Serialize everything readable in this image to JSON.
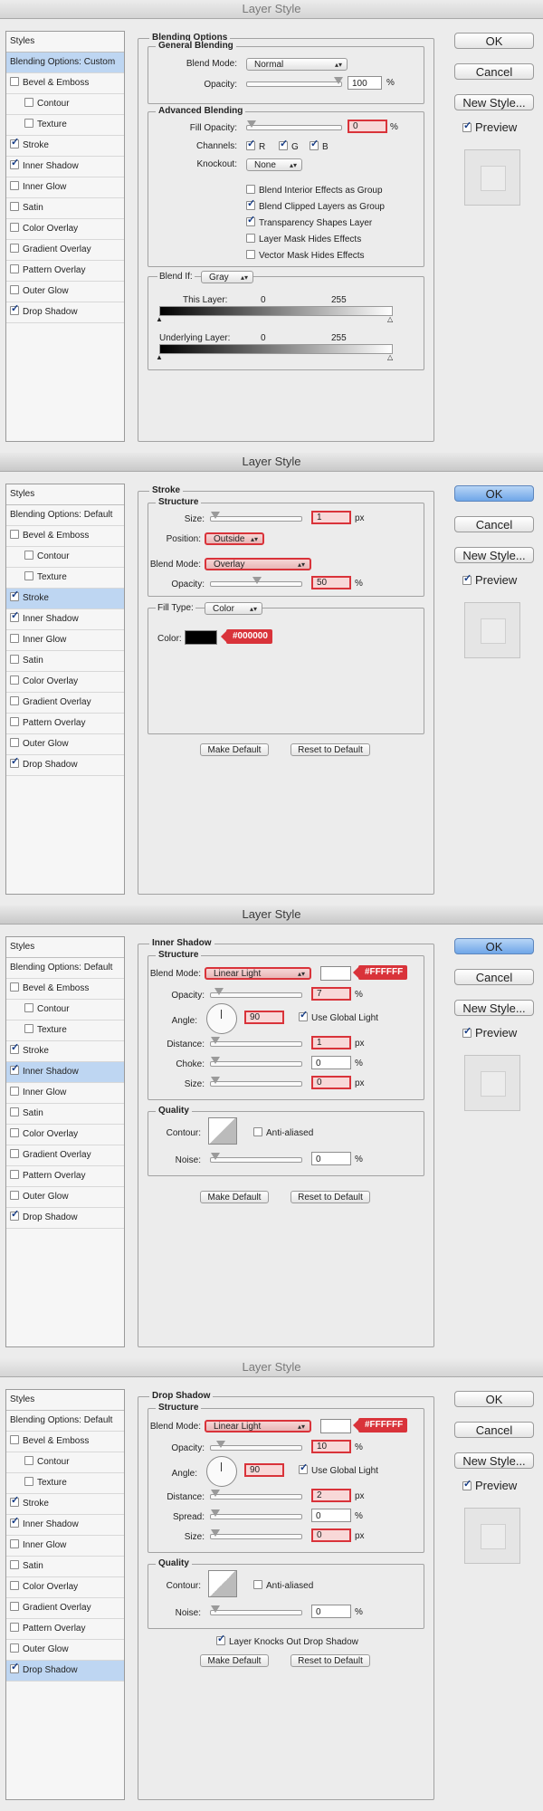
{
  "panels": [
    {
      "title": "Layer Style",
      "sidebar_header": "Styles",
      "sidebar": [
        {
          "label": "Blending Options: Custom",
          "checked": null,
          "selected": true
        },
        {
          "label": "Bevel & Emboss",
          "checked": false,
          "selected": false
        },
        {
          "label": "Contour",
          "checked": false,
          "selected": false,
          "indent": true
        },
        {
          "label": "Texture",
          "checked": false,
          "selected": false,
          "indent": true
        },
        {
          "label": "Stroke",
          "checked": true,
          "selected": false
        },
        {
          "label": "Inner Shadow",
          "checked": true,
          "selected": false
        },
        {
          "label": "Inner Glow",
          "checked": false,
          "selected": false
        },
        {
          "label": "Satin",
          "checked": false,
          "selected": false
        },
        {
          "label": "Color Overlay",
          "checked": false,
          "selected": false
        },
        {
          "label": "Gradient Overlay",
          "checked": false,
          "selected": false
        },
        {
          "label": "Pattern Overlay",
          "checked": false,
          "selected": false
        },
        {
          "label": "Outer Glow",
          "checked": false,
          "selected": false
        },
        {
          "label": "Drop Shadow",
          "checked": true,
          "selected": false
        }
      ],
      "buttons": {
        "ok": "OK",
        "cancel": "Cancel",
        "new_style": "New Style...",
        "preview": "Preview"
      },
      "section": "Blending Options",
      "general_blending": "General Blending",
      "blend_mode_label": "Blend Mode:",
      "blend_mode": "Normal",
      "opacity_label": "Opacity:",
      "opacity": "100",
      "pct": "%",
      "advanced_blending": "Advanced Blending",
      "fill_opacity_label": "Fill Opacity:",
      "fill_opacity": "0",
      "channels_label": "Channels:",
      "channels": [
        "R",
        "G",
        "B"
      ],
      "knockout_label": "Knockout:",
      "knockout": "None",
      "options": [
        {
          "label": "Blend Interior Effects as Group",
          "checked": false
        },
        {
          "label": "Blend Clipped Layers as Group",
          "checked": true
        },
        {
          "label": "Transparency Shapes Layer",
          "checked": true
        },
        {
          "label": "Layer Mask Hides Effects",
          "checked": false
        },
        {
          "label": "Vector Mask Hides Effects",
          "checked": false
        }
      ],
      "blend_if_label": "Blend If:",
      "blend_if": "Gray",
      "this_layer": "This Layer:",
      "underlying_layer": "Underlying Layer:",
      "range_low": "0",
      "range_high": "255"
    },
    {
      "title": "Layer Style",
      "sidebar_header": "Styles",
      "sidebar": [
        {
          "label": "Blending Options: Default",
          "checked": null,
          "selected": false
        },
        {
          "label": "Bevel & Emboss",
          "checked": false,
          "selected": false
        },
        {
          "label": "Contour",
          "checked": false,
          "selected": false,
          "indent": true
        },
        {
          "label": "Texture",
          "checked": false,
          "selected": false,
          "indent": true
        },
        {
          "label": "Stroke",
          "checked": true,
          "selected": true
        },
        {
          "label": "Inner Shadow",
          "checked": true,
          "selected": false
        },
        {
          "label": "Inner Glow",
          "checked": false,
          "selected": false
        },
        {
          "label": "Satin",
          "checked": false,
          "selected": false
        },
        {
          "label": "Color Overlay",
          "checked": false,
          "selected": false
        },
        {
          "label": "Gradient Overlay",
          "checked": false,
          "selected": false
        },
        {
          "label": "Pattern Overlay",
          "checked": false,
          "selected": false
        },
        {
          "label": "Outer Glow",
          "checked": false,
          "selected": false
        },
        {
          "label": "Drop Shadow",
          "checked": true,
          "selected": false
        }
      ],
      "buttons": {
        "ok": "OK",
        "cancel": "Cancel",
        "new_style": "New Style...",
        "preview": "Preview"
      },
      "section": "Stroke",
      "structure": "Structure",
      "size_label": "Size:",
      "size": "1",
      "px": "px",
      "position_label": "Position:",
      "position": "Outside",
      "blend_mode_label": "Blend Mode:",
      "blend_mode": "Overlay",
      "opacity_label": "Opacity:",
      "opacity": "50",
      "pct": "%",
      "fill_type_label": "Fill Type:",
      "fill_type": "Color",
      "color_label": "Color:",
      "color_tag": "#000000",
      "color_hex": "#000000",
      "make_default": "Make Default",
      "reset_default": "Reset to Default"
    },
    {
      "title": "Layer Style",
      "sidebar_header": "Styles",
      "sidebar": [
        {
          "label": "Blending Options: Default",
          "checked": null,
          "selected": false
        },
        {
          "label": "Bevel & Emboss",
          "checked": false,
          "selected": false
        },
        {
          "label": "Contour",
          "checked": false,
          "selected": false,
          "indent": true
        },
        {
          "label": "Texture",
          "checked": false,
          "selected": false,
          "indent": true
        },
        {
          "label": "Stroke",
          "checked": true,
          "selected": false
        },
        {
          "label": "Inner Shadow",
          "checked": true,
          "selected": true
        },
        {
          "label": "Inner Glow",
          "checked": false,
          "selected": false
        },
        {
          "label": "Satin",
          "checked": false,
          "selected": false
        },
        {
          "label": "Color Overlay",
          "checked": false,
          "selected": false
        },
        {
          "label": "Gradient Overlay",
          "checked": false,
          "selected": false
        },
        {
          "label": "Pattern Overlay",
          "checked": false,
          "selected": false
        },
        {
          "label": "Outer Glow",
          "checked": false,
          "selected": false
        },
        {
          "label": "Drop Shadow",
          "checked": true,
          "selected": false
        }
      ],
      "buttons": {
        "ok": "OK",
        "cancel": "Cancel",
        "new_style": "New Style...",
        "preview": "Preview"
      },
      "section": "Inner Shadow",
      "structure": "Structure",
      "blend_mode_label": "Blend Mode:",
      "blend_mode": "Linear Light",
      "color_tag": "#FFFFFF",
      "opacity_label": "Opacity:",
      "opacity": "7",
      "pct": "%",
      "angle_label": "Angle:",
      "angle": "90",
      "global_light": "Use Global Light",
      "distance_label": "Distance:",
      "distance": "1",
      "choke_label": "Choke:",
      "choke": "0",
      "size_label": "Size:",
      "size": "0",
      "px": "px",
      "quality": "Quality",
      "contour_label": "Contour:",
      "anti_aliased": "Anti-aliased",
      "noise_label": "Noise:",
      "noise": "0",
      "make_default": "Make Default",
      "reset_default": "Reset to Default"
    },
    {
      "title": "Layer Style",
      "sidebar_header": "Styles",
      "sidebar": [
        {
          "label": "Blending Options: Default",
          "checked": null,
          "selected": false
        },
        {
          "label": "Bevel & Emboss",
          "checked": false,
          "selected": false
        },
        {
          "label": "Contour",
          "checked": false,
          "selected": false,
          "indent": true
        },
        {
          "label": "Texture",
          "checked": false,
          "selected": false,
          "indent": true
        },
        {
          "label": "Stroke",
          "checked": true,
          "selected": false
        },
        {
          "label": "Inner Shadow",
          "checked": true,
          "selected": false
        },
        {
          "label": "Inner Glow",
          "checked": false,
          "selected": false
        },
        {
          "label": "Satin",
          "checked": false,
          "selected": false
        },
        {
          "label": "Color Overlay",
          "checked": false,
          "selected": false
        },
        {
          "label": "Gradient Overlay",
          "checked": false,
          "selected": false
        },
        {
          "label": "Pattern Overlay",
          "checked": false,
          "selected": false
        },
        {
          "label": "Outer Glow",
          "checked": false,
          "selected": false
        },
        {
          "label": "Drop Shadow",
          "checked": true,
          "selected": true
        }
      ],
      "buttons": {
        "ok": "OK",
        "cancel": "Cancel",
        "new_style": "New Style...",
        "preview": "Preview"
      },
      "section": "Drop Shadow",
      "structure": "Structure",
      "blend_mode_label": "Blend Mode:",
      "blend_mode": "Linear Light",
      "color_tag": "#FFFFFF",
      "opacity_label": "Opacity:",
      "opacity": "10",
      "pct": "%",
      "angle_label": "Angle:",
      "angle": "90",
      "global_light": "Use Global Light",
      "distance_label": "Distance:",
      "distance": "2",
      "spread_label": "Spread:",
      "spread": "0",
      "size_label": "Size:",
      "size": "0",
      "px": "px",
      "quality": "Quality",
      "contour_label": "Contour:",
      "anti_aliased": "Anti-aliased",
      "noise_label": "Noise:",
      "noise": "0",
      "knocks_out": "Layer Knocks Out Drop Shadow",
      "make_default": "Make Default",
      "reset_default": "Reset to Default"
    }
  ],
  "colors": {
    "highlight": "#d9333a",
    "selection": "#bed6f2",
    "default_button": "#6fa6e8"
  }
}
